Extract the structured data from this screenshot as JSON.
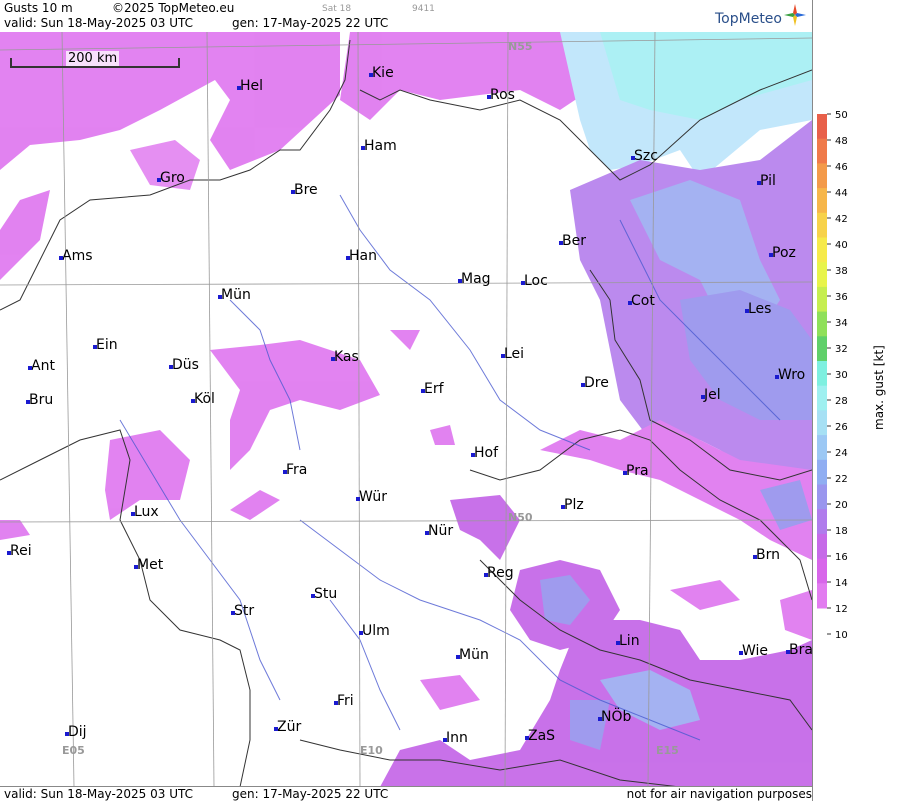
{
  "header": {
    "product": "Gusts 10 m",
    "copyright": "©2025 TopMeteo.eu",
    "sat": "Sat 18",
    "code": "9411",
    "valid": "valid:  Sun  18-May-2025  03 UTC",
    "gen": "gen: 17-May-2025 22 UTC",
    "logo": "TopMeteo"
  },
  "footer": {
    "valid": "valid:  Sun  18-May-2025  03 UTC",
    "gen": "gen: 17-May-2025 22 UTC",
    "notice": "not for air navigation purposes"
  },
  "scale_bar": "200 km",
  "grid_labels": [
    "N55",
    "N50",
    "E05",
    "E10",
    "E15"
  ],
  "legend": {
    "title": "max. gust [kt]",
    "ticks": [
      50,
      48,
      46,
      44,
      42,
      40,
      38,
      36,
      34,
      32,
      30,
      28,
      26,
      24,
      22,
      20,
      18,
      16,
      14,
      12,
      10
    ],
    "colors": [
      "#e8604a",
      "#ef7a4a",
      "#f39a4a",
      "#f6b64a",
      "#f7d24a",
      "#f6ea4a",
      "#e8f44a",
      "#c6ee50",
      "#8fe05a",
      "#5fd06a",
      "#7ef0e0",
      "#9ef0f0",
      "#a6e0f4",
      "#9cc8f4",
      "#90aef2",
      "#9a96ee",
      "#b07cec",
      "#c66ae8",
      "#d866ea",
      "#e27cf0"
    ]
  },
  "cities": [
    {
      "name": "Kie"
    },
    {
      "name": "Hel"
    },
    {
      "name": "Ros"
    },
    {
      "name": "Ham"
    },
    {
      "name": "Szc"
    },
    {
      "name": "Gro"
    },
    {
      "name": "Bre"
    },
    {
      "name": "Pil"
    },
    {
      "name": "Ber"
    },
    {
      "name": "Ams"
    },
    {
      "name": "Han"
    },
    {
      "name": "Poz"
    },
    {
      "name": "Mag"
    },
    {
      "name": "Loc"
    },
    {
      "name": "Mün"
    },
    {
      "name": "Cot"
    },
    {
      "name": "Les"
    },
    {
      "name": "Ein"
    },
    {
      "name": "Kas"
    },
    {
      "name": "Lei"
    },
    {
      "name": "Ant"
    },
    {
      "name": "Düs"
    },
    {
      "name": "Wro"
    },
    {
      "name": "Dre"
    },
    {
      "name": "Erf"
    },
    {
      "name": "Bru"
    },
    {
      "name": "Köl"
    },
    {
      "name": "Jel"
    },
    {
      "name": "Hof"
    },
    {
      "name": "Fra"
    },
    {
      "name": "Pra"
    },
    {
      "name": "Lux"
    },
    {
      "name": "Wür"
    },
    {
      "name": "Plz"
    },
    {
      "name": "Rei"
    },
    {
      "name": "Nür"
    },
    {
      "name": "Met"
    },
    {
      "name": "Brn"
    },
    {
      "name": "Reg"
    },
    {
      "name": "Stu"
    },
    {
      "name": "Str"
    },
    {
      "name": "Ulm"
    },
    {
      "name": "Lin"
    },
    {
      "name": "Mün"
    },
    {
      "name": "Wie"
    },
    {
      "name": "Bra"
    },
    {
      "name": "Fri"
    },
    {
      "name": "NÖb"
    },
    {
      "name": "Dij"
    },
    {
      "name": "Zür"
    },
    {
      "name": "Inn"
    },
    {
      "name": "ZaS"
    }
  ]
}
